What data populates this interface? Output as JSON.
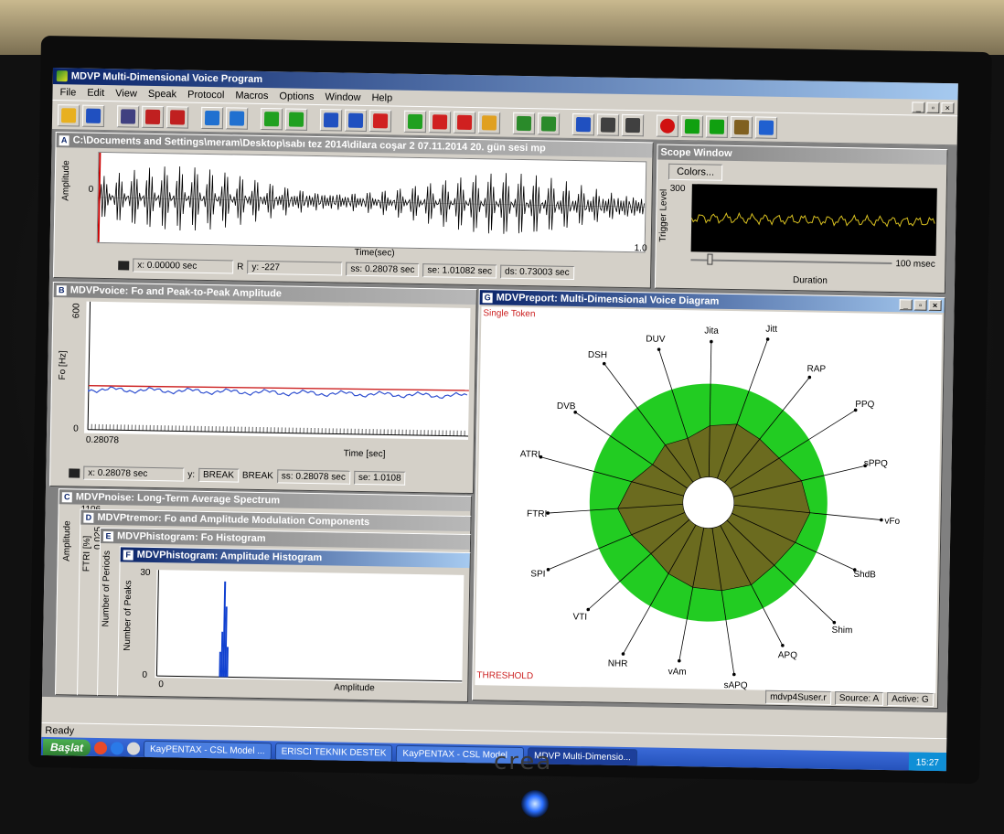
{
  "app": {
    "title": "MDVP Multi-Dimensional Voice Program",
    "menu": [
      "File",
      "Edit",
      "View",
      "Speak",
      "Protocol",
      "Macros",
      "Options",
      "Window",
      "Help"
    ]
  },
  "toolbar_icons": [
    "open-icon",
    "save-icon",
    "record-icon",
    "export-icon",
    "import-icon",
    "copy-icon",
    "paste-icon",
    "back-icon",
    "forward-icon",
    "zoom-out-icon",
    "zoom-in-icon",
    "delete-icon",
    "download-icon",
    "window-icon",
    "window2-icon",
    "s-icon",
    "analyze-icon",
    "analyze2-icon",
    "info-icon",
    "grid-icon",
    "list-icon",
    "record-dot-icon",
    "play-icon",
    "play-step-icon",
    "speaker-icon",
    "help-icon"
  ],
  "window_a": {
    "letter": "A",
    "title": "C:\\Documents and Settings\\meram\\Desktop\\sabı tez 2014\\dilara coşar 2 07.11.2014 20. gün sesi mp",
    "ylabel": "Amplitude",
    "zero": "0",
    "xlabel": "Time(sec)",
    "x_end": "1.0",
    "x_field": "x: 0.00000 sec",
    "r_label": "R",
    "y_field": "y: -227",
    "ss": "ss: 0.28078 sec",
    "se": "se: 1.01082 sec",
    "ds": "ds: 0.73003 sec"
  },
  "scope": {
    "title": "Scope Window",
    "colors_button": "Colors...",
    "trigger_label": "Trigger Level",
    "trigger_value": "300",
    "duration_value": "100 msec",
    "duration_label": "Duration"
  },
  "window_b": {
    "letter": "B",
    "title": "MDVPvoice: Fo and Peak-to-Peak Amplitude",
    "ylabel": "Fo [Hz]",
    "y_top": "600",
    "y_bottom": "0",
    "x_start": "0.28078",
    "xlabel": "Time [sec]",
    "x_field": "x: 0.28078 sec",
    "y_label": "y:",
    "break1": "BREAK",
    "break2": "BREAK",
    "ss": "ss: 0.28078 sec",
    "se": "se: 1.0108"
  },
  "window_c": {
    "letter": "C",
    "title": "MDVPnoise: Long-Term Average Spectrum",
    "ylabel": "Amplitude",
    "y_top": "1106"
  },
  "window_d": {
    "letter": "D",
    "title": "MDVPtremor: Fo and Amplitude Modulation Components",
    "ylabel": "FTRI [%]",
    "y_top": "0.025",
    "y_low": "0.000"
  },
  "window_e": {
    "letter": "E",
    "title": "MDVPhistogram: Fo Histogram",
    "ylabel": "Number of Periods"
  },
  "window_f": {
    "letter": "F",
    "title": "MDVPhistogram: Amplitude Histogram",
    "ylabel": "Number of Peaks",
    "y_top": "30",
    "y_bottom": "0",
    "x_start": "0",
    "xlabel": "Amplitude"
  },
  "window_g": {
    "letter": "G",
    "title": "MDVPreport: Multi-Dimensional Voice Diagram",
    "token_label": "Single Token",
    "threshold_label": "THRESHOLD",
    "status_user": "mdvp4Suser.r",
    "status_source": "Source: A",
    "status_active": "Active: G",
    "params": [
      "Jita",
      "Jitt",
      "RAP",
      "PPQ",
      "sPPQ",
      "vFo",
      "ShdB",
      "Shim",
      "APQ",
      "sAPQ",
      "vAm",
      "NHR",
      "VTI",
      "SPI",
      "FTRI",
      "ATRI",
      "DVB",
      "DSH",
      "DUV"
    ],
    "values": [
      0.55,
      0.62,
      0.6,
      0.62,
      0.75,
      0.82,
      0.75,
      0.7,
      0.72,
      0.68,
      0.65,
      0.6,
      0.55,
      0.62,
      0.7,
      0.58,
      0.45,
      0.5,
      0.45
    ]
  },
  "statusbar": {
    "text": "Ready"
  },
  "taskbar": {
    "start": "Başlat",
    "buttons": [
      "KayPENTAX - CSL Model ...",
      "ERISCI TEKNIK DESTEK",
      "KayPENTAX - CSL Model ...",
      "MDVP Multi-Dimensio..."
    ],
    "clock": "15:27"
  },
  "monitor": {
    "brand": "crea"
  },
  "colors": {
    "green": "#22cc22",
    "olive": "#6b6b1f",
    "fo_blue": "#3050d0",
    "fo_red": "#cc2020",
    "scope_wave": "#d8c020"
  }
}
